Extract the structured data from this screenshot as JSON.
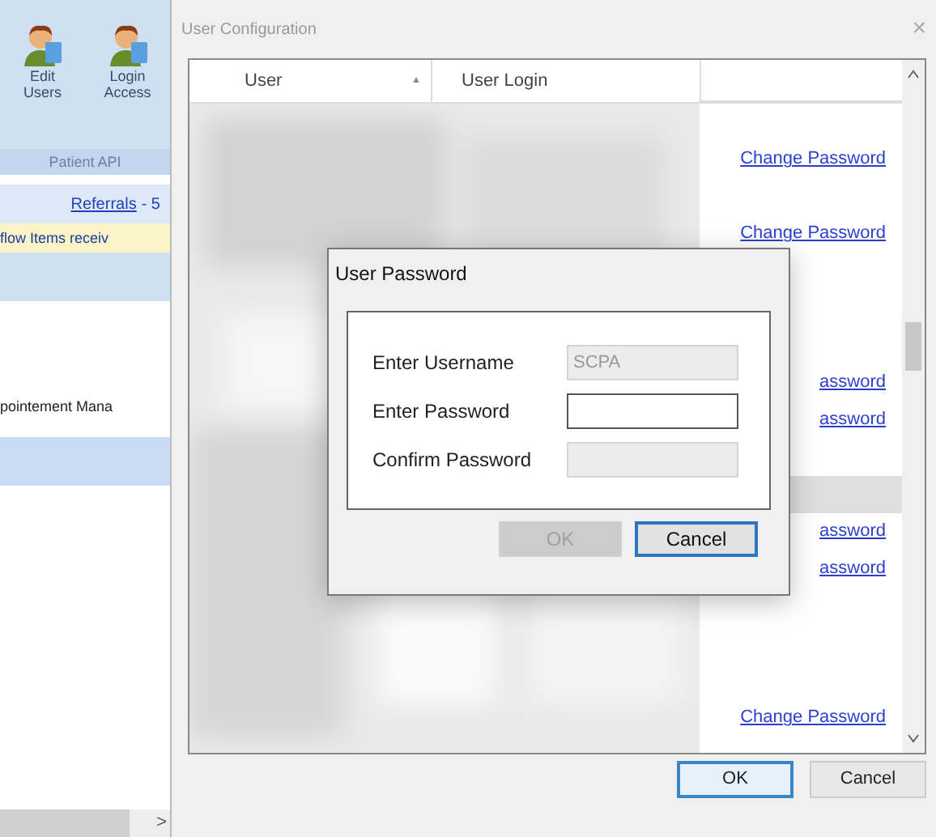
{
  "side_panel": {
    "tools": [
      {
        "label": "Edit Users"
      },
      {
        "label": "Login Access"
      }
    ],
    "section": "Patient API",
    "referrals_link": "Referrals",
    "referrals_count": "- 5",
    "notice": "flow Items receiv",
    "menu_item": "pointement Mana",
    "scroll_arrow": ">"
  },
  "window": {
    "title": "User Configuration",
    "close": "×"
  },
  "table": {
    "columns": [
      "User",
      "User Login"
    ],
    "sort_arrow": "▲",
    "rows": [
      {
        "link": null,
        "selected": false
      },
      {
        "link": "Change Password",
        "selected": false
      },
      {
        "link": null,
        "selected": false
      },
      {
        "link": "Change Password",
        "selected": false
      },
      {
        "link": null,
        "selected": false
      },
      {
        "link": null,
        "selected": false
      },
      {
        "link": null,
        "selected": false
      },
      {
        "link": "assword",
        "selected": false
      },
      {
        "link": "assword",
        "selected": false
      },
      {
        "link": null,
        "selected": false
      },
      {
        "link": null,
        "selected": true
      },
      {
        "link": "assword",
        "selected": false
      },
      {
        "link": "assword",
        "selected": false
      },
      {
        "link": null,
        "selected": false
      },
      {
        "link": null,
        "selected": false
      },
      {
        "link": null,
        "selected": false
      },
      {
        "link": "Change Password",
        "selected": false
      }
    ]
  },
  "buttons": [
    {
      "label": "OK",
      "default": true
    },
    {
      "label": "Cancel",
      "default": false
    }
  ],
  "dialog": {
    "title": "User Password",
    "fields": [
      {
        "label": "Enter Username",
        "value": "SCPA",
        "disabled": true
      },
      {
        "label": "Enter Password",
        "disabled": false
      },
      {
        "label": "Confirm Password",
        "disabled": true
      }
    ],
    "buttons": [
      {
        "label": "OK",
        "disabled": true,
        "default": false
      },
      {
        "label": "Cancel",
        "disabled": false,
        "default": true
      }
    ]
  }
}
